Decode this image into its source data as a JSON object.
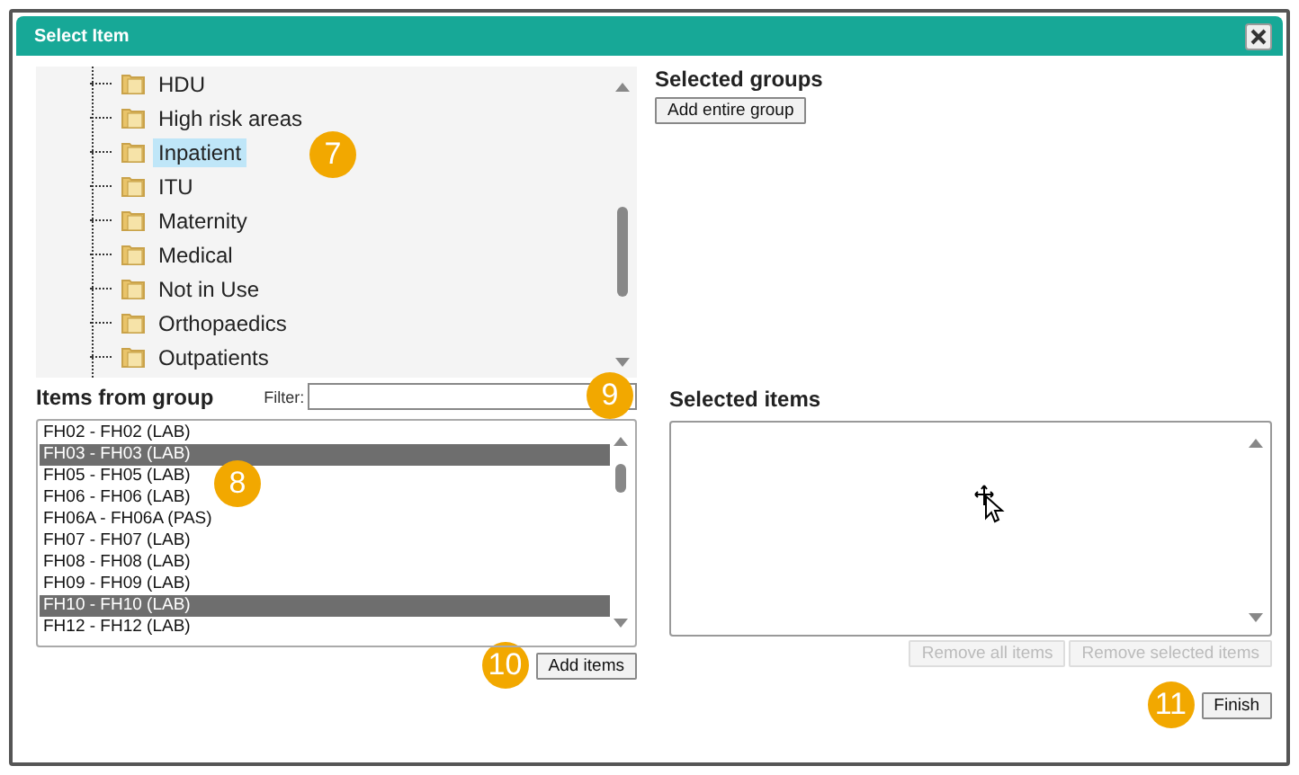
{
  "window": {
    "title": "Select Item"
  },
  "tree": {
    "items": [
      {
        "label": "HDU",
        "selected": false
      },
      {
        "label": "High risk areas",
        "selected": false
      },
      {
        "label": "Inpatient",
        "selected": true,
        "callout": "7"
      },
      {
        "label": "ITU",
        "selected": false
      },
      {
        "label": "Maternity",
        "selected": false
      },
      {
        "label": "Medical",
        "selected": false
      },
      {
        "label": "Not in Use",
        "selected": false
      },
      {
        "label": "Orthopaedics",
        "selected": false
      },
      {
        "label": "Outpatients",
        "selected": false
      }
    ]
  },
  "items_from_group": {
    "title": "Items from group",
    "filter": {
      "label": "Filter:",
      "callout": "9"
    },
    "callout": "8",
    "items": [
      {
        "label": "FH02 - FH02 (LAB)",
        "selected": false
      },
      {
        "label": "FH03 - FH03 (LAB)",
        "selected": true
      },
      {
        "label": "FH05 - FH05 (LAB)",
        "selected": false
      },
      {
        "label": "FH06 - FH06 (LAB)",
        "selected": false
      },
      {
        "label": "FH06A - FH06A (PAS)",
        "selected": false
      },
      {
        "label": "FH07 - FH07 (LAB)",
        "selected": false
      },
      {
        "label": "FH08 - FH08 (LAB)",
        "selected": false
      },
      {
        "label": "FH09 - FH09 (LAB)",
        "selected": false
      },
      {
        "label": "FH10 - FH10 (LAB)",
        "selected": true
      },
      {
        "label": "FH12 - FH12 (LAB)",
        "selected": false
      }
    ],
    "add_button": {
      "label": "Add items",
      "callout": "10"
    }
  },
  "selected_groups": {
    "title": "Selected groups",
    "button": {
      "label": "Add entire group",
      "disabled": false
    }
  },
  "selected_items": {
    "title": "Selected items",
    "buttons": [
      {
        "label": "Remove all items",
        "disabled": true
      },
      {
        "label": "Remove selected items",
        "disabled": true
      }
    ]
  },
  "finish_button": {
    "label": "Finish",
    "callout": "11"
  }
}
